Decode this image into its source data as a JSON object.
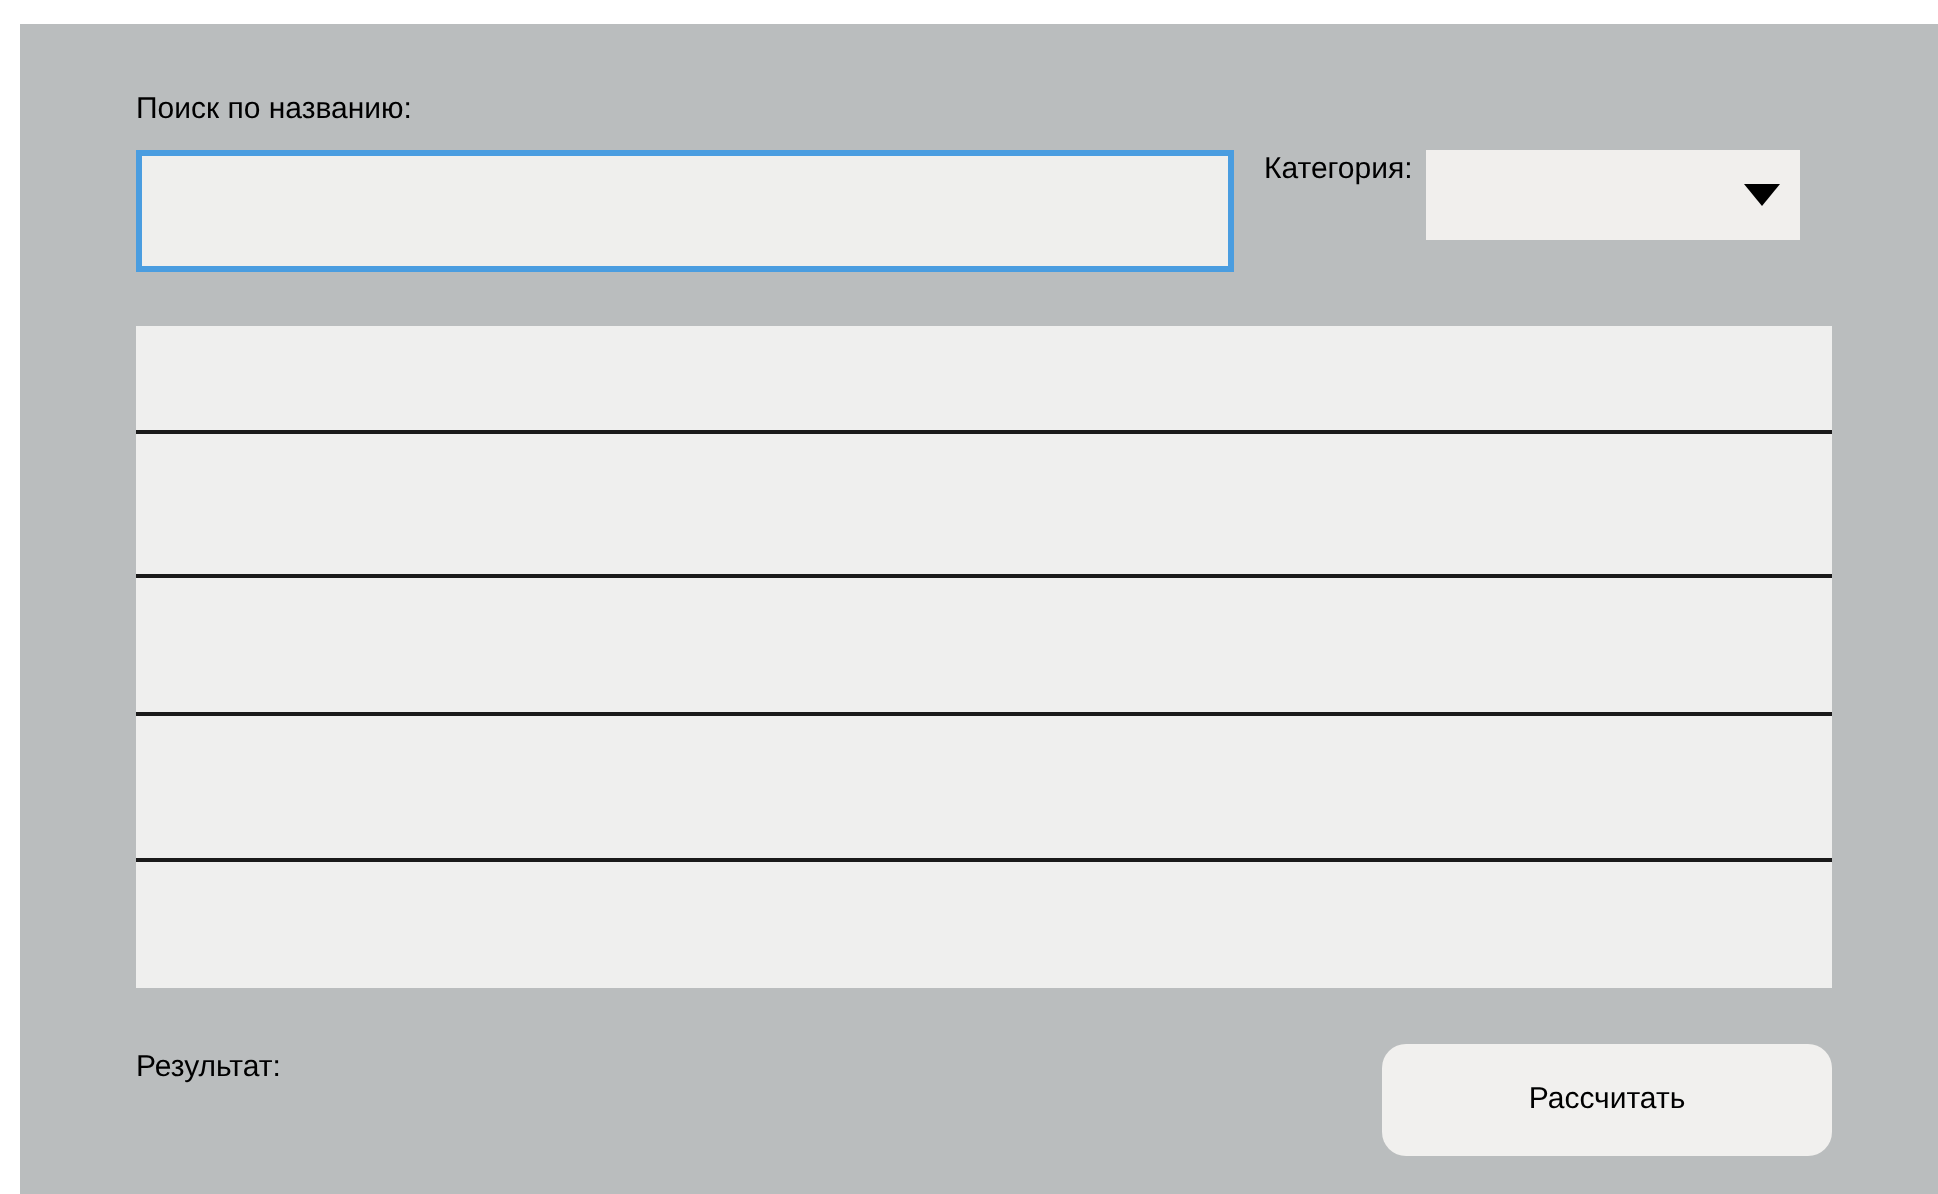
{
  "search": {
    "label": "Поиск по названию:",
    "focused": true
  },
  "category": {
    "label": "Категория:"
  },
  "result": {
    "label": "Результат:"
  },
  "buttons": [
    {
      "label": "Рассчитать"
    }
  ]
}
